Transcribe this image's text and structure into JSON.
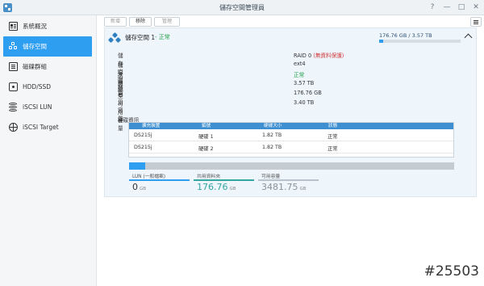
{
  "window": {
    "title": "儲存空間管理員",
    "help": "?",
    "minimize": "—",
    "maximize": "□",
    "close": "✕"
  },
  "sidebar": {
    "items": [
      {
        "label": "系統概況",
        "icon": "overview-icon",
        "active": false
      },
      {
        "label": "儲存空間",
        "icon": "storage-pool-icon",
        "active": true
      },
      {
        "label": "磁碟群組",
        "icon": "disk-group-icon",
        "active": false
      },
      {
        "label": "HDD/SSD",
        "icon": "hdd-icon",
        "active": false
      },
      {
        "label": "iSCSI LUN",
        "icon": "iscsi-lun-icon",
        "active": false
      },
      {
        "label": "iSCSI Target",
        "icon": "globe-icon",
        "active": false
      }
    ]
  },
  "toolbar": {
    "create": "新增",
    "remove": "移除",
    "manage": "管理"
  },
  "pool": {
    "name": "儲存空間 1",
    "status": "- 正常",
    "usage_summary": "176.76 GB / 3.57 TB",
    "usage_fraction": 0.05,
    "info": [
      {
        "label": "儲存空間類型",
        "value": "RAID 0",
        "note": "(無資料保護)"
      },
      {
        "label": "檔案系統",
        "value": "ext4"
      },
      {
        "label": "狀態",
        "value": "正常",
        "status": "ok"
      },
      {
        "label": "容量",
        "value": "3.57 TB"
      },
      {
        "label": "已用容量",
        "value": "176.76 GB"
      },
      {
        "label": "可用容量",
        "value": "3.40 TB"
      }
    ],
    "disk_title": "硬碟資訊",
    "disk_headers": [
      "擴充裝置",
      "編號",
      "硬碟大小",
      "狀態"
    ],
    "disks": [
      {
        "enclosure": "DS215j",
        "slot": "硬碟 1",
        "size": "1.82 TB",
        "status": "正常"
      },
      {
        "enclosure": "DS215j",
        "slot": "硬碟 2",
        "size": "1.82 TB",
        "status": "正常"
      }
    ],
    "capacity_fraction": 0.05,
    "legend": [
      {
        "label": "LUN (一般檔案)",
        "value": "0",
        "unit": "GB",
        "color": "#2e9ef0"
      },
      {
        "label": "共用資料夾",
        "value": "176.76",
        "unit": "GB",
        "color": "#33a6a2"
      },
      {
        "label": "可用容量",
        "value": "3481.75",
        "unit": "GB",
        "color": "#b9c2ca"
      }
    ]
  },
  "watermark": "#25503"
}
